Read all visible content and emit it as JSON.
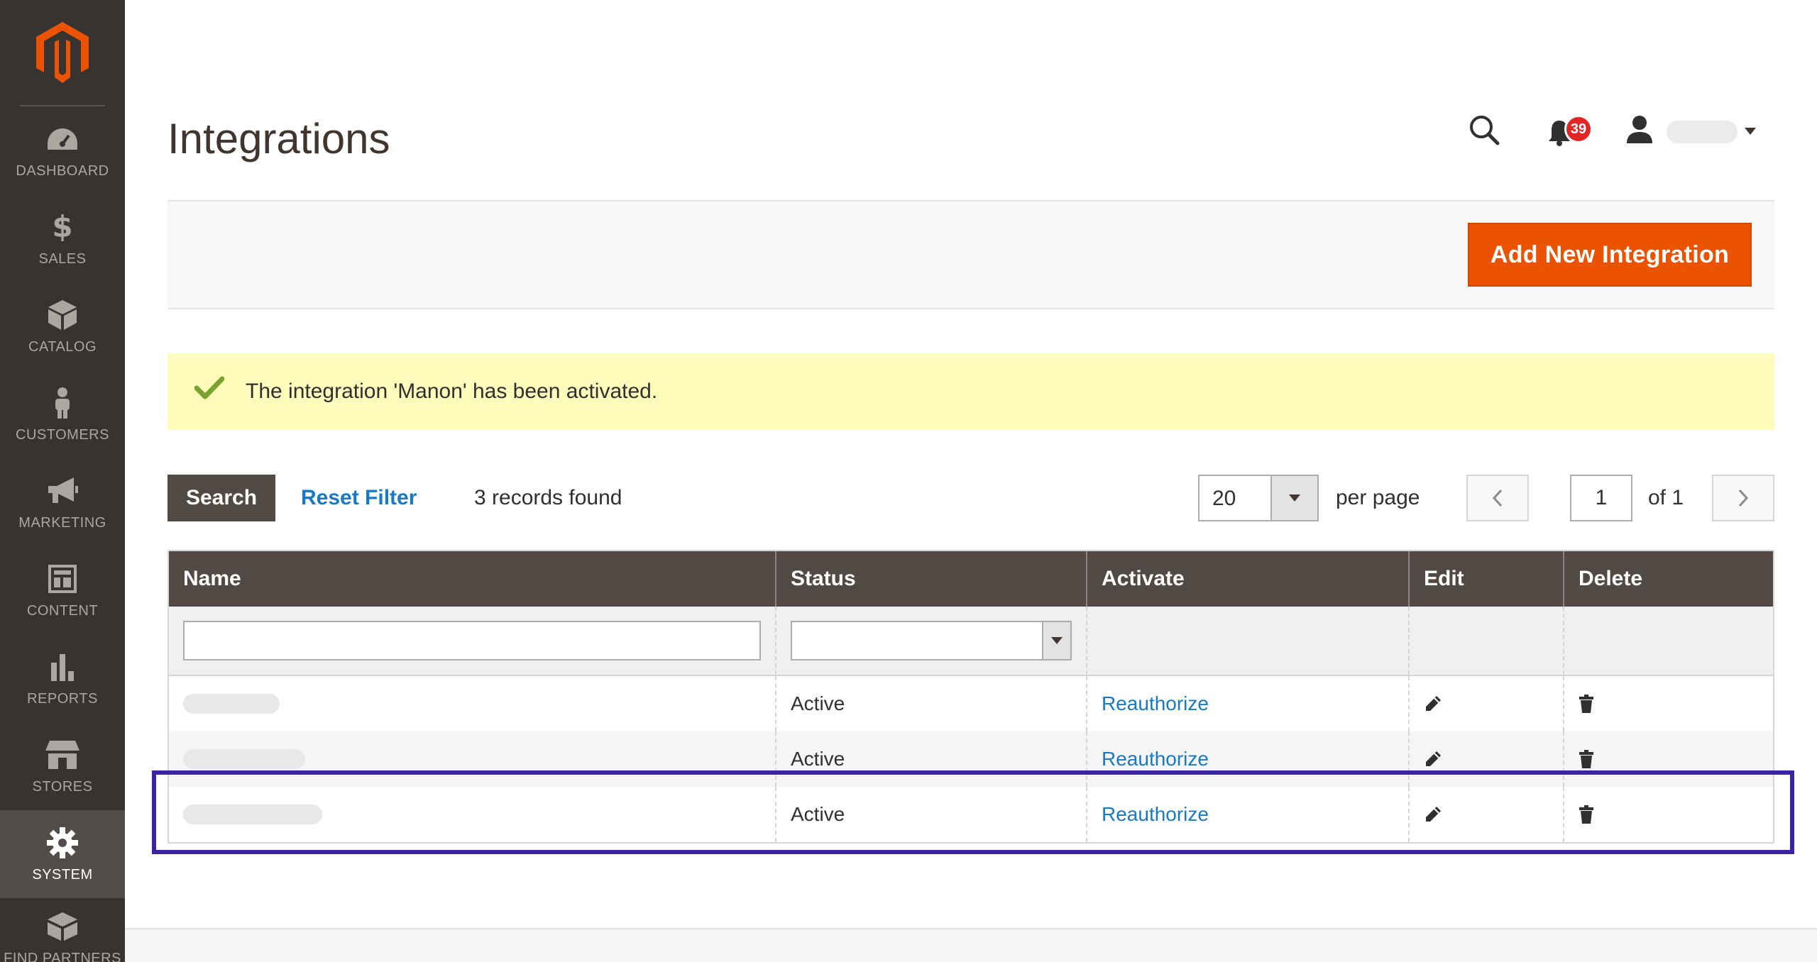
{
  "sidebar": {
    "items": [
      {
        "label": "DASHBOARD",
        "icon": "speedometer-icon"
      },
      {
        "label": "SALES",
        "icon": "dollar-icon"
      },
      {
        "label": "CATALOG",
        "icon": "box-icon"
      },
      {
        "label": "CUSTOMERS",
        "icon": "person-icon"
      },
      {
        "label": "MARKETING",
        "icon": "megaphone-icon"
      },
      {
        "label": "CONTENT",
        "icon": "layout-icon"
      },
      {
        "label": "REPORTS",
        "icon": "bar-chart-icon"
      },
      {
        "label": "STORES",
        "icon": "storefront-icon"
      },
      {
        "label": "SYSTEM",
        "icon": "gear-icon",
        "active": true
      },
      {
        "label": "FIND PARTNERS",
        "icon": "blocks-icon"
      }
    ]
  },
  "header": {
    "title": "Integrations",
    "notification_count": "39"
  },
  "actions": {
    "add_button": "Add New Integration"
  },
  "message": {
    "text": "The integration 'Manon' has been activated."
  },
  "toolbar": {
    "search_button": "Search",
    "reset_filter": "Reset Filter",
    "records_found": "3 records found",
    "per_page_value": "20",
    "per_page_label": "per page",
    "current_page": "1",
    "page_of": "of 1"
  },
  "grid": {
    "columns": [
      "Name",
      "Status",
      "Activate",
      "Edit",
      "Delete"
    ],
    "rows": [
      {
        "status": "Active",
        "activate": "Reauthorize"
      },
      {
        "status": "Active",
        "activate": "Reauthorize"
      },
      {
        "status": "Active",
        "activate": "Reauthorize"
      }
    ]
  },
  "colors": {
    "accent": "#eb5202",
    "sidebar": "#373330",
    "table_header": "#514943",
    "link": "#1979c3",
    "highlight": "#3a23a6"
  }
}
